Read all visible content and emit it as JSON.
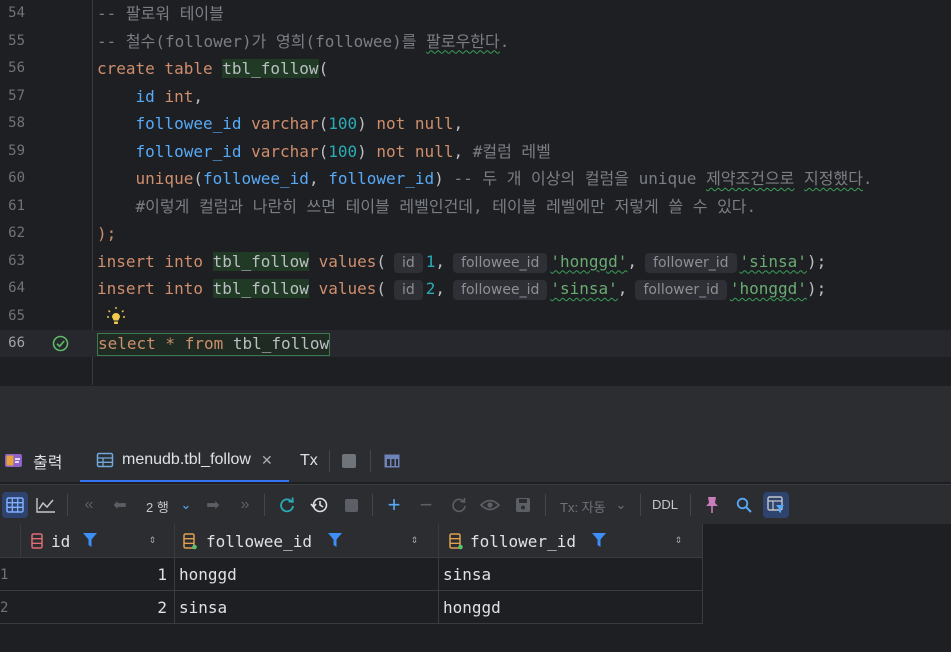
{
  "editor": {
    "lines": [
      {
        "n": "54",
        "parts": [
          {
            "t": "-- 팔로워 테이블",
            "c": "cmt"
          }
        ]
      },
      {
        "n": "55",
        "parts": [
          {
            "t": "-- 철수(follower)가 영희(followee)를 팔로우한다.",
            "c": "cmt"
          }
        ]
      },
      {
        "n": "56",
        "parts": [
          {
            "t": "create table ",
            "c": "kw"
          },
          {
            "t": "tbl_follow",
            "c": "tbl"
          },
          {
            "t": "(",
            "c": "p"
          }
        ]
      },
      {
        "n": "57",
        "parts": [
          {
            "t": "    ",
            "c": "p"
          },
          {
            "t": "id",
            "c": "fn"
          },
          {
            "t": " ",
            "c": "p"
          },
          {
            "t": "int",
            "c": "kw"
          },
          {
            "t": ",",
            "c": "p"
          }
        ]
      },
      {
        "n": "58",
        "parts": [
          {
            "t": "    ",
            "c": "p"
          },
          {
            "t": "followee_id",
            "c": "fn"
          },
          {
            "t": " ",
            "c": "p"
          },
          {
            "t": "varchar",
            "c": "kw"
          },
          {
            "t": "(",
            "c": "p"
          },
          {
            "t": "100",
            "c": "num"
          },
          {
            "t": ") ",
            "c": "p"
          },
          {
            "t": "not null",
            "c": "kw"
          },
          {
            "t": ",",
            "c": "p"
          }
        ]
      },
      {
        "n": "59",
        "parts": [
          {
            "t": "    ",
            "c": "p"
          },
          {
            "t": "follower_id",
            "c": "fn"
          },
          {
            "t": " ",
            "c": "p"
          },
          {
            "t": "varchar",
            "c": "kw"
          },
          {
            "t": "(",
            "c": "p"
          },
          {
            "t": "100",
            "c": "num"
          },
          {
            "t": ") ",
            "c": "p"
          },
          {
            "t": "not null",
            "c": "kw"
          },
          {
            "t": ", ",
            "c": "p"
          },
          {
            "t": "#컬럼 레벨",
            "c": "cmt"
          }
        ]
      },
      {
        "n": "60",
        "parts": [
          {
            "t": "    ",
            "c": "p"
          },
          {
            "t": "unique",
            "c": "kw"
          },
          {
            "t": "(",
            "c": "p"
          },
          {
            "t": "followee_id",
            "c": "fn"
          },
          {
            "t": ", ",
            "c": "p"
          },
          {
            "t": "follower_id",
            "c": "fn"
          },
          {
            "t": ") ",
            "c": "p"
          },
          {
            "t": "-- 두 개 이상의 컬럼을 unique 제약조건으로 지정했다.",
            "c": "cmt"
          }
        ]
      },
      {
        "n": "61",
        "parts": [
          {
            "t": "    ",
            "c": "p"
          },
          {
            "t": "#이렇게 컬럼과 나란히 쓰면 테이블 레벨인건데, 테이블 레벨에만 저렇게 쓸 수 있다.",
            "c": "cmt"
          }
        ]
      },
      {
        "n": "62",
        "parts": [
          {
            "t": ");",
            "c": "kw"
          }
        ]
      },
      {
        "n": "63",
        "parts": [
          {
            "t": "insert into ",
            "c": "kw"
          },
          {
            "t": "tbl_follow",
            "c": "tbl"
          },
          {
            "t": " ",
            "c": "p"
          },
          {
            "t": "values",
            "c": "kw"
          },
          {
            "t": "(",
            "c": "p"
          },
          {
            "h": "id"
          },
          {
            "t": "1",
            "c": "num"
          },
          {
            "t": ",",
            "c": "p"
          },
          {
            "h": "followee_id"
          },
          {
            "t": "'honggd'",
            "c": "str"
          },
          {
            "t": ",",
            "c": "p"
          },
          {
            "h": "follower_id"
          },
          {
            "t": "'sinsa'",
            "c": "str"
          },
          {
            "t": ");",
            "c": "p"
          }
        ]
      },
      {
        "n": "64",
        "parts": [
          {
            "t": "insert into ",
            "c": "kw"
          },
          {
            "t": "tbl_follow",
            "c": "tbl"
          },
          {
            "t": " ",
            "c": "p"
          },
          {
            "t": "values",
            "c": "kw"
          },
          {
            "t": "(",
            "c": "p"
          },
          {
            "h": "id"
          },
          {
            "t": "2",
            "c": "num"
          },
          {
            "t": ",",
            "c": "p"
          },
          {
            "h": "followee_id"
          },
          {
            "t": "'sinsa'",
            "c": "str"
          },
          {
            "t": ",",
            "c": "p"
          },
          {
            "h": "follower_id"
          },
          {
            "t": "'honggd'",
            "c": "str"
          },
          {
            "t": ");",
            "c": "p"
          }
        ]
      },
      {
        "n": "65",
        "parts": [],
        "bulb": true
      },
      {
        "n": "66",
        "parts": [
          {
            "t": "select * from ",
            "c": "kw"
          },
          {
            "t": "tbl_follow",
            "c": "p"
          }
        ],
        "current": true,
        "check": true,
        "boxed": true
      }
    ]
  },
  "toolwindow": {
    "output_tab": "출력",
    "result_tab": "menudb.tbl_follow",
    "tx_tab": "Tx"
  },
  "toolbar": {
    "rows_label": "2 행",
    "tx_label": "Tx: 자동",
    "ddl_label": "DDL"
  },
  "grid": {
    "columns": [
      "id",
      "followee_id",
      "follower_id"
    ],
    "rows": [
      {
        "row_num": "1",
        "id": "1",
        "followee_id": "honggd",
        "follower_id": "sinsa"
      },
      {
        "row_num": "2",
        "id": "2",
        "followee_id": "sinsa",
        "follower_id": "honggd"
      }
    ]
  },
  "colors": {
    "keyword": "#cf8e6d",
    "identifier": "#57aaf7",
    "number": "#2aacb8",
    "string": "#6aab73",
    "comment": "#7a7e85",
    "accent": "#3574f0"
  }
}
